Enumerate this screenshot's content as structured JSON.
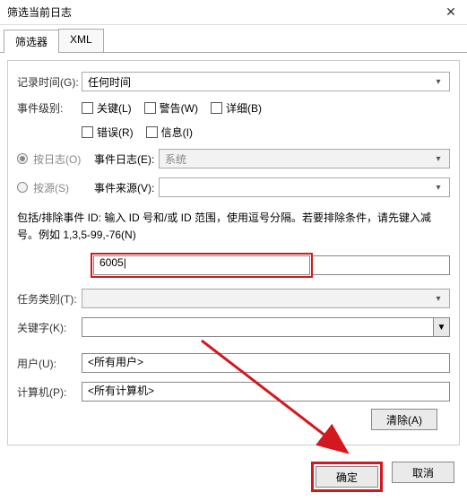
{
  "title": "筛选当前日志",
  "tabs": {
    "filter": "筛选器",
    "xml": "XML"
  },
  "labels": {
    "logTime": "记录时间(G):",
    "eventLevel": "事件级别:",
    "byLog": "按日志(O)",
    "bySource": "按源(S)",
    "eventLog": "事件日志(E):",
    "eventSource": "事件来源(V):",
    "taskCategory": "任务类别(T):",
    "keywords": "关键字(K):",
    "user": "用户(U):",
    "computer": "计算机(P):"
  },
  "values": {
    "logTime": "任何时间",
    "eventLog": "系统",
    "eventSource": "",
    "eventId": "6005",
    "taskCategory": "",
    "keywords": "",
    "user": "<所有用户>",
    "computer": "<所有计算机>"
  },
  "checkboxes": {
    "critical": "关键(L)",
    "warning": "警告(W)",
    "verbose": "详细(B)",
    "error": "错误(R)",
    "info": "信息(I)"
  },
  "helpText": "包括/排除事件 ID: 输入 ID 号和/或 ID 范围，使用逗号分隔。若要排除条件，请先键入减号。例如 1,3,5-99,-76(N)",
  "buttons": {
    "clear": "清除(A)",
    "ok": "确定",
    "cancel": "取消"
  }
}
